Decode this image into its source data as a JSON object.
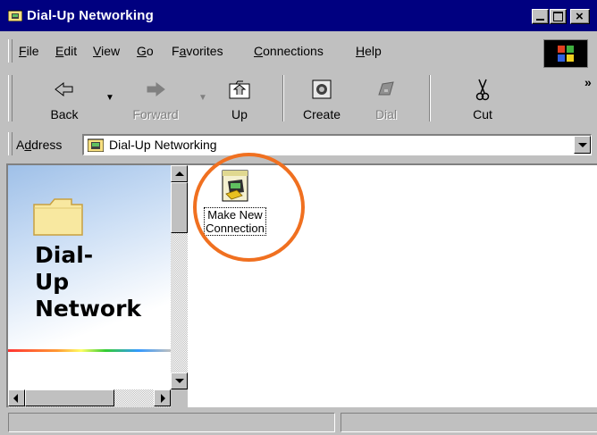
{
  "window": {
    "title": "Dial-Up Networking"
  },
  "menu": {
    "items": [
      {
        "pre": "",
        "u": "F",
        "post": "ile"
      },
      {
        "pre": "",
        "u": "E",
        "post": "dit"
      },
      {
        "pre": "",
        "u": "V",
        "post": "iew"
      },
      {
        "pre": "",
        "u": "G",
        "post": "o"
      },
      {
        "pre": "F",
        "u": "a",
        "post": "vorites"
      },
      {
        "pre": "",
        "u": "C",
        "post": "onnections"
      },
      {
        "pre": "",
        "u": "H",
        "post": "elp"
      }
    ]
  },
  "toolbar": {
    "back_label": "Back",
    "forward_label": "Forward",
    "up_label": "Up",
    "create_label": "Create",
    "dial_label": "Dial",
    "cut_label": "Cut",
    "more_label": "»"
  },
  "address": {
    "label_pre": "A",
    "label_u": "d",
    "label_post": "dress",
    "value": "Dial-Up Networking"
  },
  "left_pane": {
    "title": "Dial-\nUp\nNetwork"
  },
  "items": [
    {
      "label_line1": "Make New",
      "label_line2": "Connection",
      "icon": "make-new-connection-icon"
    }
  ],
  "status": {
    "panel1": "",
    "panel2": ""
  },
  "colors": {
    "titlebar": "#000080",
    "highlight_circle": "#f07020",
    "face": "#c0c0c0"
  }
}
